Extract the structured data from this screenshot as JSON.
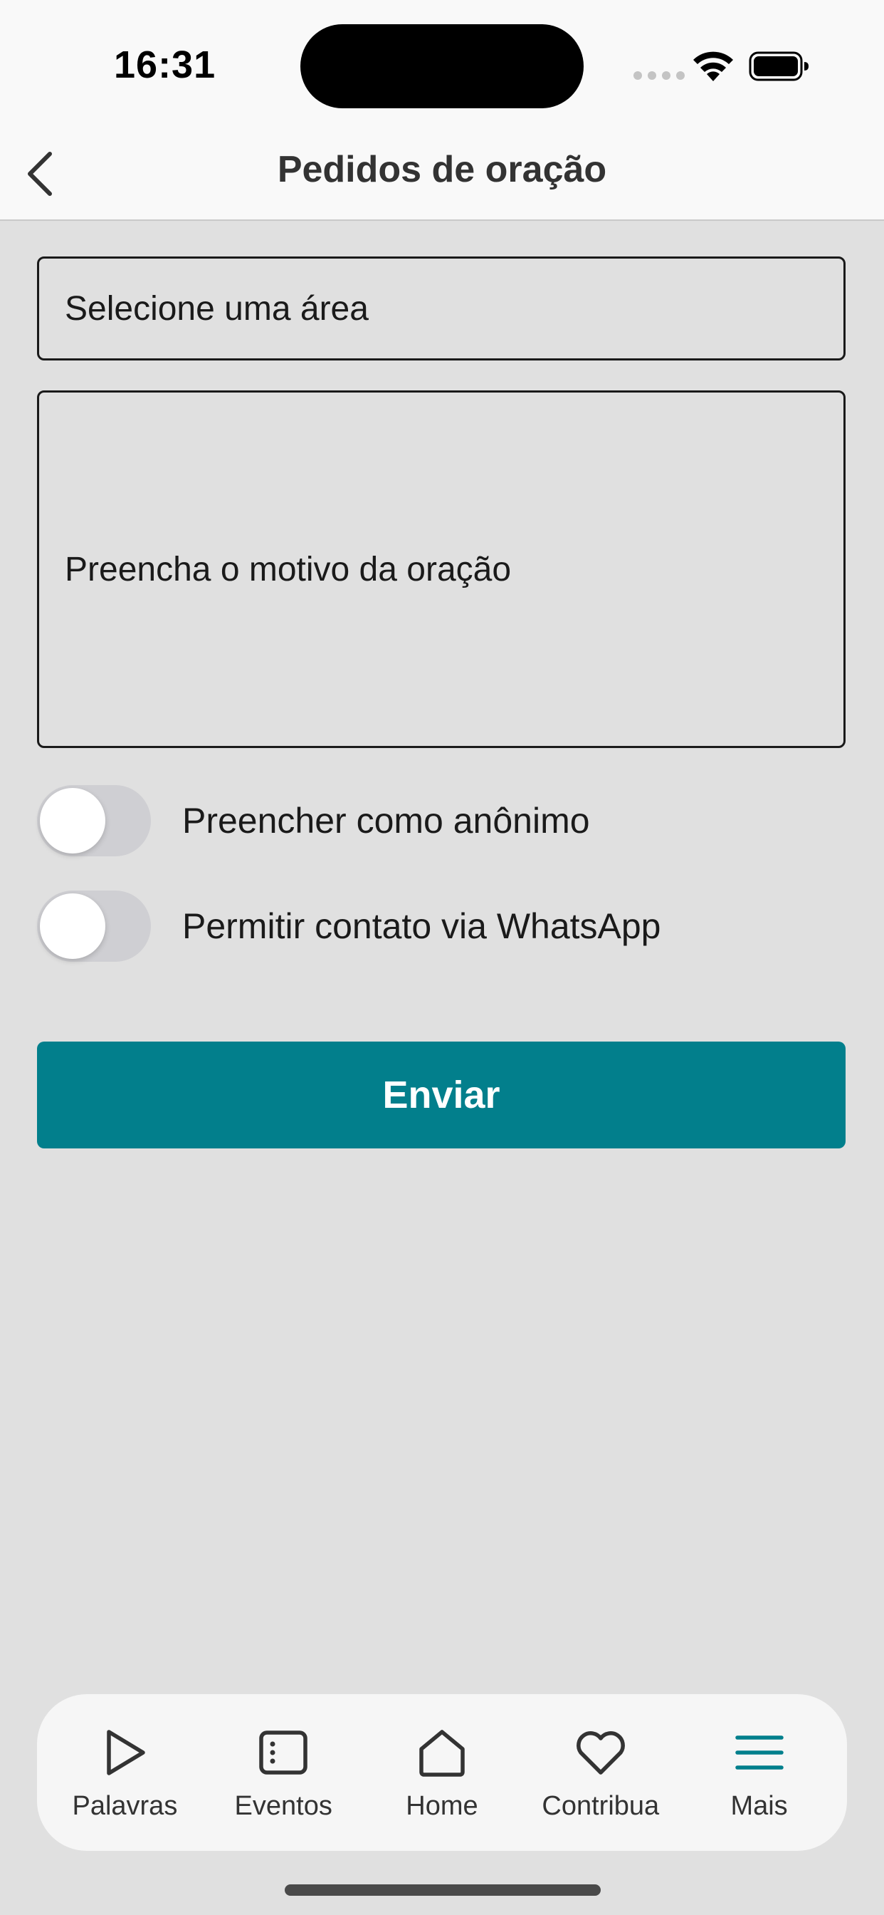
{
  "status_bar": {
    "time": "16:31"
  },
  "nav": {
    "title": "Pedidos de oração",
    "back_icon": "chevron-left-icon"
  },
  "form": {
    "area_select_placeholder": "Selecione uma área",
    "reason_placeholder": "Preencha o motivo da oração",
    "toggles": [
      {
        "label": "Preencher como anônimo",
        "on": false
      },
      {
        "label": "Permitir contato via WhatsApp",
        "on": false
      }
    ],
    "submit_label": "Enviar"
  },
  "tab_bar": {
    "items": [
      {
        "label": "Palavras",
        "icon": "play-icon",
        "active": false
      },
      {
        "label": "Eventos",
        "icon": "calendar-card-icon",
        "active": false
      },
      {
        "label": "Home",
        "icon": "home-icon",
        "active": false
      },
      {
        "label": "Contribua",
        "icon": "heart-icon",
        "active": false
      },
      {
        "label": "Mais",
        "icon": "menu-icon",
        "active": true
      }
    ]
  },
  "colors": {
    "accent": "#027f8c",
    "background": "#e0e0e0",
    "bar_background": "#f9f9f9"
  }
}
